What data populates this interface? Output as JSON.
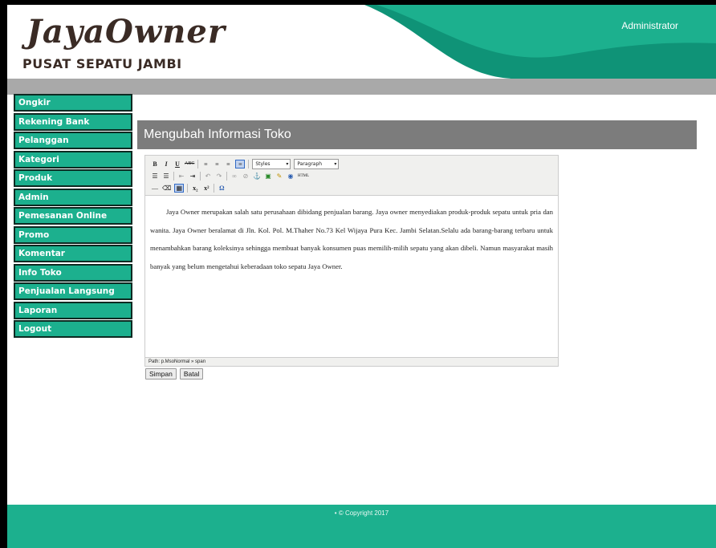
{
  "header": {
    "brand": "JayaOwner",
    "brand_sub": "PUSAT SEPATU JAMBI",
    "user": "Administrator",
    "colors": {
      "teal": "#1cb08e",
      "dark_teal": "#0f9377"
    }
  },
  "sidebar": {
    "items": [
      {
        "label": "Ongkir"
      },
      {
        "label": "Rekening Bank"
      },
      {
        "label": "Pelanggan"
      },
      {
        "label": "Kategori"
      },
      {
        "label": "Produk"
      },
      {
        "label": "Admin"
      },
      {
        "label": "Pemesanan Online"
      },
      {
        "label": "Promo"
      },
      {
        "label": "Komentar"
      },
      {
        "label": "Info Toko"
      },
      {
        "label": "Penjualan Langsung"
      },
      {
        "label": "Laporan"
      },
      {
        "label": "Logout"
      }
    ]
  },
  "main": {
    "title": "Mengubah Informasi Toko",
    "editor": {
      "styles_select": "Styles",
      "format_select": "Paragraph",
      "content": "Jaya Owner merupakan salah satu perusahaan dibidang penjualan barang. Jaya owner menyediakan produk-produk sepatu untuk pria dan wanita. Jaya Owner beralamat di Jln. Kol. Pol. M.Thaher No.73 Kel Wijaya Pura Kec. Jambi Selatan.Selalu ada barang-barang terbaru untuk menambahkan barang koleksinya sehingga membuat banyak konsumen puas memilih-milih sepatu yang akan dibeli. Namun masyarakat masih banyak yang belum mengetahui keberadaan toko sepatu Jaya Owner.",
      "path": "Path: p.MsoNormal » span"
    },
    "buttons": {
      "save": "Simpan",
      "cancel": "Batal"
    }
  },
  "footer": {
    "copyright": "• © Copyright 2017"
  }
}
